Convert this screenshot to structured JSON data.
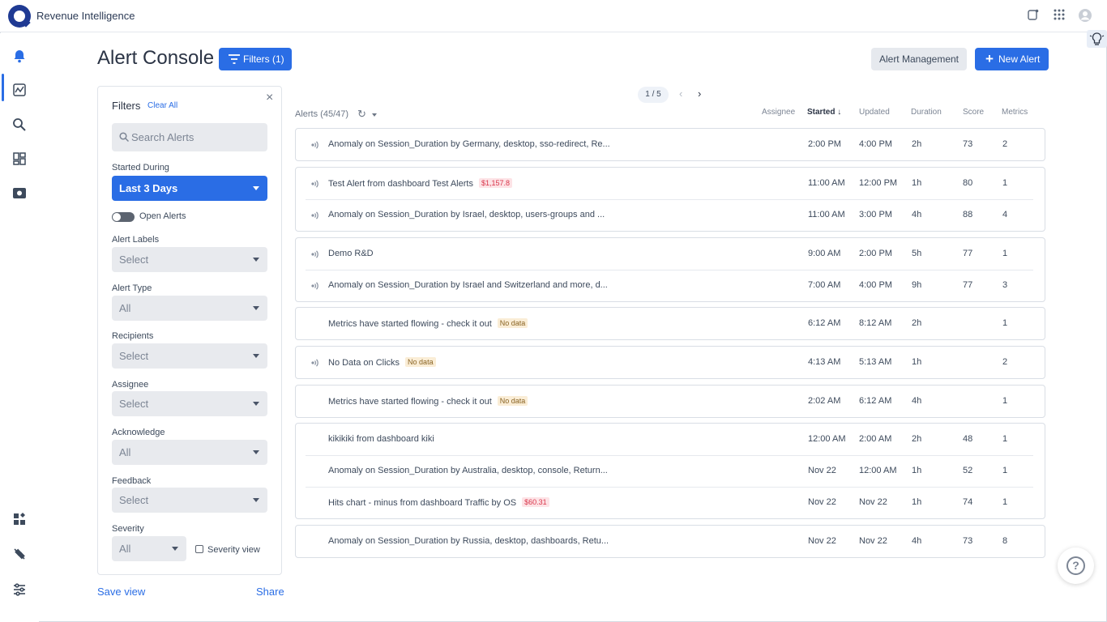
{
  "app": {
    "title": "Revenue Intelligence"
  },
  "header": {
    "title": "Alert Console",
    "filters_button": "Filters (1)",
    "alert_management": "Alert Management",
    "new_alert": "New Alert"
  },
  "filters": {
    "title": "Filters",
    "clear_all": "Clear All",
    "search_placeholder": "Search Alerts",
    "started_during": {
      "label": "Started During",
      "value": "Last 3 Days"
    },
    "open_alerts": "Open Alerts",
    "alert_labels": {
      "label": "Alert Labels",
      "value": "Select"
    },
    "alert_type": {
      "label": "Alert Type",
      "value": "All"
    },
    "recipients": {
      "label": "Recipients",
      "value": "Select"
    },
    "assignee": {
      "label": "Assignee",
      "value": "Select"
    },
    "acknowledge": {
      "label": "Acknowledge",
      "value": "All"
    },
    "feedback": {
      "label": "Feedback",
      "value": "Select"
    },
    "severity": {
      "label": "Severity",
      "value": "All"
    },
    "severity_view": "Severity view",
    "save_view": "Save view",
    "share": "Share"
  },
  "list": {
    "pager": "1 / 5",
    "count": "Alerts (45/47)",
    "columns": {
      "assignee": "Assignee",
      "started": "Started",
      "updated": "Updated",
      "duration": "Duration",
      "score": "Score",
      "metrics": "Metrics"
    },
    "groups": [
      [
        {
          "title": "Anomaly on Session_Duration by Germany, desktop, sso-redirect, Re...",
          "signal": true,
          "started": "2:00 PM",
          "updated": "4:00 PM",
          "duration": "2h",
          "score": "73",
          "metrics": "2"
        }
      ],
      [
        {
          "title": "Test Alert from dashboard Test Alerts",
          "tag": "$1,157.8",
          "tag_type": "money",
          "signal": true,
          "started": "11:00 AM",
          "updated": "12:00 PM",
          "duration": "1h",
          "score": "80",
          "metrics": "1"
        },
        {
          "title": "Anomaly on Session_Duration by Israel, desktop, users-groups and ...",
          "signal": true,
          "started": "11:00 AM",
          "updated": "3:00 PM",
          "duration": "4h",
          "score": "88",
          "metrics": "4"
        }
      ],
      [
        {
          "title": "Demo R&D",
          "signal": true,
          "started": "9:00 AM",
          "updated": "2:00 PM",
          "duration": "5h",
          "score": "77",
          "metrics": "1"
        },
        {
          "title": "Anomaly on Session_Duration by Israel and Switzerland and more, d...",
          "signal": true,
          "started": "7:00 AM",
          "updated": "4:00 PM",
          "duration": "9h",
          "score": "77",
          "metrics": "3"
        }
      ],
      [
        {
          "title": "Metrics have started flowing - check it out",
          "tag": "No data",
          "tag_type": "nodata",
          "signal": false,
          "started": "6:12 AM",
          "updated": "8:12 AM",
          "duration": "2h",
          "score": "",
          "metrics": "1"
        }
      ],
      [
        {
          "title": "No Data on Clicks",
          "tag": "No data",
          "tag_type": "nodata",
          "signal": true,
          "started": "4:13 AM",
          "updated": "5:13 AM",
          "duration": "1h",
          "score": "",
          "metrics": "2"
        }
      ],
      [
        {
          "title": "Metrics have started flowing - check it out",
          "tag": "No data",
          "tag_type": "nodata",
          "signal": false,
          "started": "2:02 AM",
          "updated": "6:12 AM",
          "duration": "4h",
          "score": "",
          "metrics": "1"
        }
      ],
      [
        {
          "title": "kikikiki from dashboard kiki",
          "signal": false,
          "started": "12:00 AM",
          "updated": "2:00 AM",
          "duration": "2h",
          "score": "48",
          "metrics": "1"
        },
        {
          "title": "Anomaly on Session_Duration by Australia, desktop, console, Return...",
          "signal": false,
          "started": "Nov 22",
          "updated": "12:00 AM",
          "duration": "1h",
          "score": "52",
          "metrics": "1"
        },
        {
          "title": "Hits chart - minus from dashboard Traffic by OS",
          "tag": "$60.31",
          "tag_type": "money",
          "signal": false,
          "started": "Nov 22",
          "updated": "Nov 22",
          "duration": "1h",
          "score": "74",
          "metrics": "1"
        }
      ],
      [
        {
          "title": "Anomaly on Session_Duration by Russia, desktop, dashboards, Retu...",
          "signal": false,
          "started": "Nov 22",
          "updated": "Nov 22",
          "duration": "4h",
          "score": "73",
          "metrics": "8"
        }
      ]
    ]
  }
}
